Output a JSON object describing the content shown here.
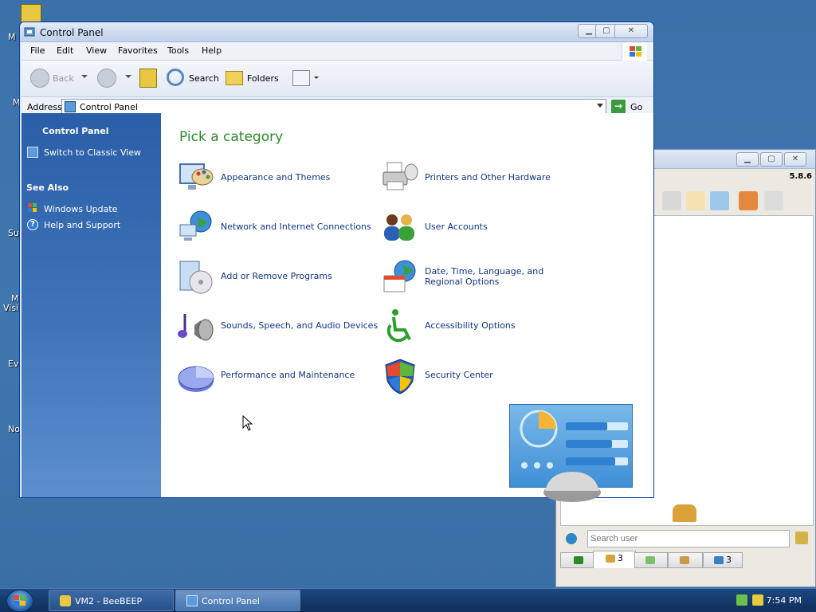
{
  "desktop": {
    "labels": [
      "M",
      "M",
      "Su",
      "M",
      "Visi",
      "Ev",
      "No"
    ]
  },
  "beebeep": {
    "version": "5.8.6",
    "search_placeholder": "Search user",
    "tabs": [
      {
        "label": ""
      },
      {
        "label": "3"
      },
      {
        "label": ""
      },
      {
        "label": ""
      },
      {
        "label": "3"
      }
    ]
  },
  "control_panel": {
    "title": "Control Panel",
    "menu": [
      "File",
      "Edit",
      "View",
      "Favorites",
      "Tools",
      "Help"
    ],
    "toolbar": {
      "back": "Back",
      "search": "Search",
      "folders": "Folders"
    },
    "address": {
      "label": "Address",
      "value": "Control Panel",
      "go": "Go"
    },
    "sidebar": {
      "heading": "Control Panel",
      "switch_view": "Switch to Classic View",
      "see_also": "See Also",
      "links": [
        "Windows Update",
        "Help and Support"
      ]
    },
    "main": {
      "title": "Pick a category",
      "categories": [
        "Appearance and Themes",
        "Printers and Other Hardware",
        "Network and Internet Connections",
        "User Accounts",
        "Add or Remove Programs",
        "Date, Time, Language, and Regional Options",
        "Sounds, Speech, and Audio Devices",
        "Accessibility Options",
        "Performance and Maintenance",
        "Security Center"
      ]
    }
  },
  "taskbar": {
    "buttons": [
      "VM2 - BeeBEEP",
      "Control Panel"
    ],
    "clock": "7:54 PM"
  }
}
